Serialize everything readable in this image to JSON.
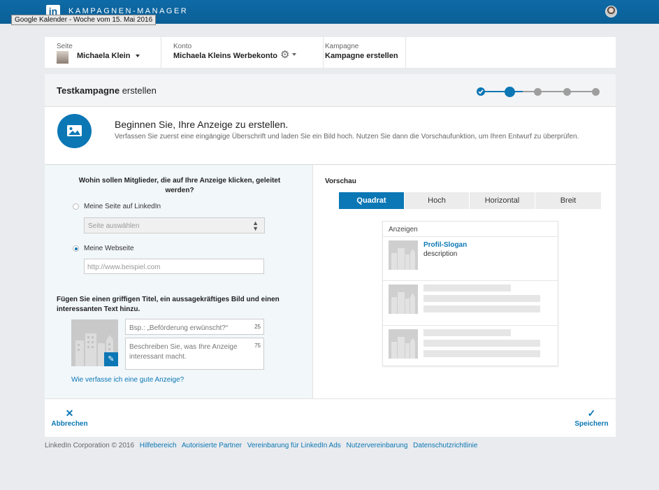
{
  "topbar": {
    "logo": "in",
    "brand": "KAMPAGNEN-MANAGER",
    "tooltip": "Google Kalender - Woche vom 15. Mai 2016"
  },
  "breadcrumb": [
    {
      "label": "Seite",
      "value": "Michaela Klein"
    },
    {
      "label": "Konto",
      "value": "Michaela Kleins Werbekonto"
    },
    {
      "label": "Kampagne",
      "value": "Kampagne erstellen"
    }
  ],
  "header": {
    "title_bold": "Testkampagne",
    "title_rest": " erstellen",
    "steps_total": 5,
    "steps_completed": 1,
    "current_step": 2
  },
  "intro": {
    "title": "Beginnen Sie, Ihre Anzeige zu erstellen.",
    "text": "Verfassen Sie zuerst eine eingängige Überschrift und laden Sie ein Bild hoch. Nutzen Sie dann die Vorschaufunktion, um Ihren Entwurf zu überprüfen."
  },
  "form": {
    "question": "Wohin sollen Mitglieder, die auf Ihre Anzeige klicken, geleitet werden?",
    "option_linkedin": "Meine Seite auf LinkedIn",
    "select_placeholder": "Seite auswählen",
    "option_website": "Meine Webseite",
    "selected_option": "website",
    "url_placeholder": "http://www.beispiel.com",
    "content_heading": "Fügen Sie einen griffigen Titel, ein aussagekräftiges Bild und einen interessanten Text hinzu.",
    "title_placeholder": "Bsp.: „Beförderung erwünscht?“",
    "title_counter": "25",
    "desc_placeholder": "Beschreiben Sie, was Ihre Anzeige interessant macht.",
    "desc_counter": "75",
    "help_link": "Wie verfasse ich eine gute Anzeige?"
  },
  "preview": {
    "label": "Vorschau",
    "tabs": [
      "Quadrat",
      "Hoch",
      "Horizontal",
      "Breit"
    ],
    "active_tab": "Quadrat",
    "ads_heading": "Anzeigen",
    "slogan": "Profil-Slogan",
    "description": "description"
  },
  "footer_actions": {
    "cancel": "Abbrechen",
    "save": "Speichern"
  },
  "page_footer": {
    "copyright": "LinkedIn Corporation © 2016",
    "links": [
      "Hilfebereich",
      "Autorisierte Partner",
      "Vereinbarung für LinkedIn Ads",
      "Nutzervereinbarung",
      "Datenschutzrichtlinie"
    ]
  },
  "colors": {
    "topbar": "#0b5f96",
    "accent": "#0b77b5",
    "step_inactive": "#9e9e9e"
  }
}
